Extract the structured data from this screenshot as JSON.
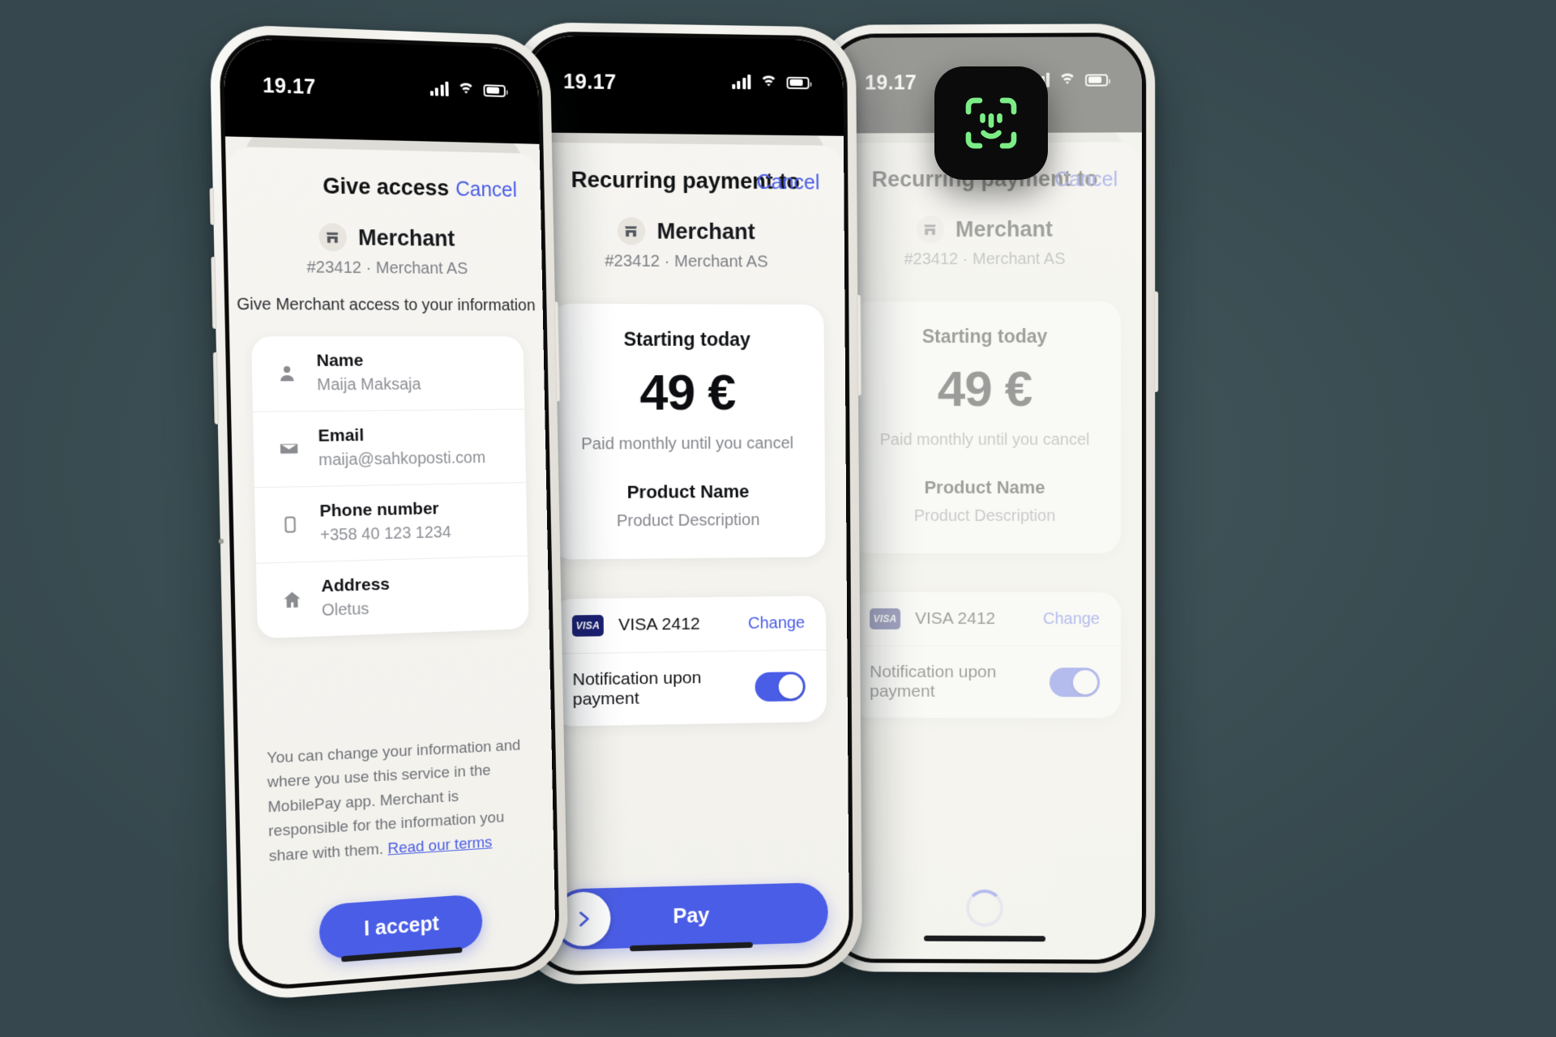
{
  "background_color": "#3e5257",
  "accent_color": "#4a5de6",
  "status_bar": {
    "time": "19.17",
    "icons": [
      "cellular-signal-icon",
      "wifi-icon",
      "battery-icon"
    ]
  },
  "phones": [
    {
      "id": "give-access",
      "title": "Give access",
      "cancel_label": "Cancel",
      "merchant": {
        "name": "Merchant",
        "subtitle": "#23412 · Merchant AS",
        "icon": "storefront-icon"
      },
      "access_note": "Give Merchant access to your information",
      "info_rows": [
        {
          "icon": "person-icon",
          "label": "Name",
          "value": "Maija Maksaja"
        },
        {
          "icon": "envelope-icon",
          "label": "Email",
          "value": "maija@sahkoposti.com"
        },
        {
          "icon": "smartphone-icon",
          "label": "Phone number",
          "value": "+358 40 123 1234"
        },
        {
          "icon": "home-icon",
          "label": "Address",
          "value": "Oletus"
        }
      ],
      "disclaimer": "You can change your information and where you use this service in the MobilePay app. Merchant is responsible for the information you share with them. ",
      "terms_link": "Read our terms",
      "accept_label": "I accept"
    },
    {
      "id": "recurring-payment",
      "title": "Recurring payment to",
      "cancel_label": "Cancel",
      "merchant": {
        "name": "Merchant",
        "subtitle": "#23412 · Merchant AS",
        "icon": "storefront-icon"
      },
      "payment": {
        "starting": "Starting today",
        "amount": "49 €",
        "paid_note": "Paid monthly until you cancel",
        "product_name": "Product Name",
        "product_description": "Product Description"
      },
      "method": {
        "brand": "VISA",
        "label": "VISA 2412",
        "change_label": "Change",
        "notification_label": "Notification upon payment",
        "notification_on": true
      },
      "pay_label": "Pay"
    },
    {
      "id": "recurring-payment-authenticating",
      "title": "Recurring payment to",
      "cancel_label": "Cancel",
      "merchant": {
        "name": "Merchant",
        "subtitle": "#23412 · Merchant AS",
        "icon": "storefront-icon"
      },
      "payment": {
        "starting": "Starting today",
        "amount": "49 €",
        "paid_note": "Paid monthly until you cancel",
        "product_name": "Product Name",
        "product_description": "Product Description"
      },
      "method": {
        "brand": "VISA",
        "label": "VISA 2412",
        "change_label": "Change",
        "notification_label": "Notification upon payment",
        "notification_on": true
      },
      "faceid": {
        "icon": "face-id-icon",
        "color": "#7ced86"
      }
    }
  ]
}
